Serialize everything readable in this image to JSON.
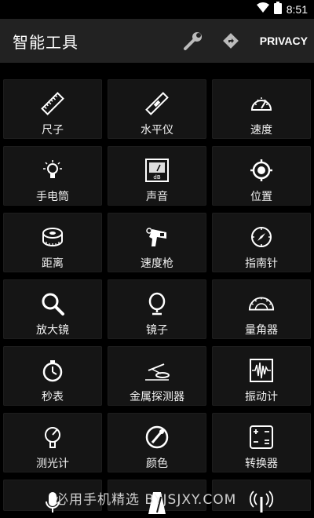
{
  "status": {
    "time": "8:51"
  },
  "appbar": {
    "title": "智能工具",
    "privacy_label": "PRIVACY",
    "wrench_icon": "wrench-icon",
    "navigate_icon": "navigate-icon"
  },
  "tools": [
    {
      "label": "尺子",
      "icon": "ruler-icon"
    },
    {
      "label": "水平仪",
      "icon": "level-icon"
    },
    {
      "label": "速度",
      "icon": "speedometer-icon"
    },
    {
      "label": "手电筒",
      "icon": "flashlight-icon"
    },
    {
      "label": "声音",
      "icon": "sound-meter-icon"
    },
    {
      "label": "位置",
      "icon": "location-icon"
    },
    {
      "label": "距离",
      "icon": "tape-measure-icon"
    },
    {
      "label": "速度枪",
      "icon": "speed-gun-icon"
    },
    {
      "label": "指南针",
      "icon": "compass-icon"
    },
    {
      "label": "放大镜",
      "icon": "magnifier-icon"
    },
    {
      "label": "镜子",
      "icon": "mirror-icon"
    },
    {
      "label": "量角器",
      "icon": "protractor-icon"
    },
    {
      "label": "秒表",
      "icon": "stopwatch-icon"
    },
    {
      "label": "金属探测器",
      "icon": "metal-detector-icon"
    },
    {
      "label": "振动计",
      "icon": "vibrometer-icon"
    },
    {
      "label": "测光计",
      "icon": "light-meter-icon"
    },
    {
      "label": "颜色",
      "icon": "color-picker-icon"
    },
    {
      "label": "转换器",
      "icon": "converter-icon"
    }
  ],
  "partial_row_icons": [
    "microphone-icon",
    "metronome-icon",
    "signal-icon"
  ],
  "watermark": "必用手机精选 BYJSJXY.COM"
}
